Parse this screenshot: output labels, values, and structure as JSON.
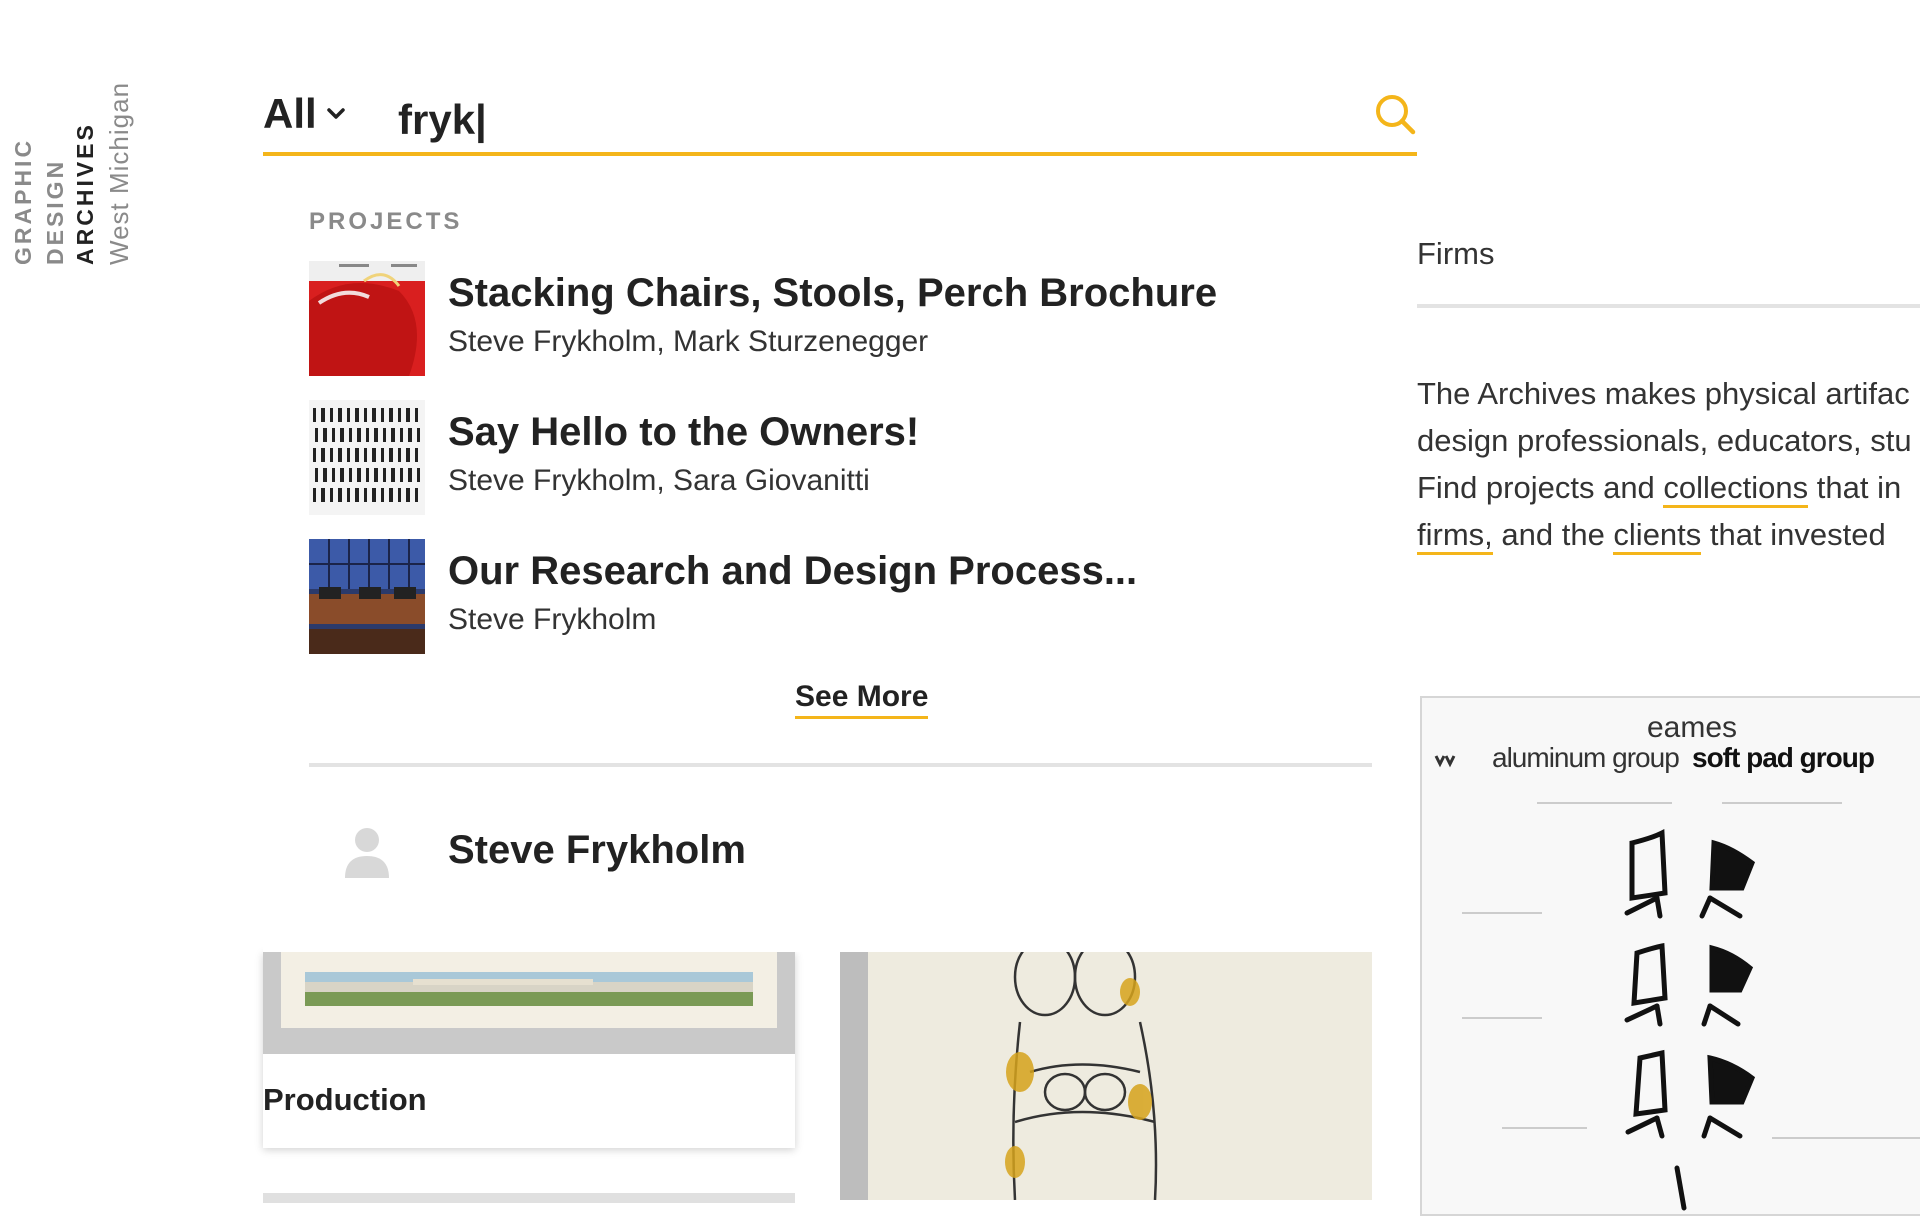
{
  "logo": {
    "line1": "GRAPHIC",
    "line2": "DESIGN",
    "line3": "ARCHIVES",
    "line4": "West Michigan"
  },
  "search": {
    "scope_label": "All",
    "query": "fryk|",
    "placeholder": ""
  },
  "dropdown": {
    "projects_heading": "PROJECTS",
    "projects": [
      {
        "title": "Stacking Chairs, Stools, Perch Brochure",
        "authors": "Steve Frykholm, Mark Sturzenegger"
      },
      {
        "title": "Say Hello to the Owners!",
        "authors": "Steve Frykholm, Sara Giovanitti"
      },
      {
        "title": "Our Research and Design Process...",
        "authors": "Steve Frykholm"
      }
    ],
    "see_more": "See More",
    "person": {
      "name": "Steve Frykholm"
    }
  },
  "sidebar": {
    "firms_tab": "Firms",
    "intro": {
      "line1": "The Archives makes physical artifac",
      "line2": "design professionals, educators, stu",
      "line3_a": "Find projects and ",
      "link_collections": "collections",
      "line3_b": " that in",
      "link_firms": "firms,",
      "line4_a": " and the ",
      "link_clients": "clients",
      "line4_b": " that invested"
    }
  },
  "poster": {
    "brand": "eames",
    "subtitle_light": "aluminum group",
    "subtitle_bold": "soft pad group"
  },
  "cards": {
    "production_label": "Production"
  },
  "colors": {
    "accent": "#f4b51a",
    "text": "#222222",
    "muted": "#8a8a8a",
    "divider": "#e3e3e3"
  }
}
